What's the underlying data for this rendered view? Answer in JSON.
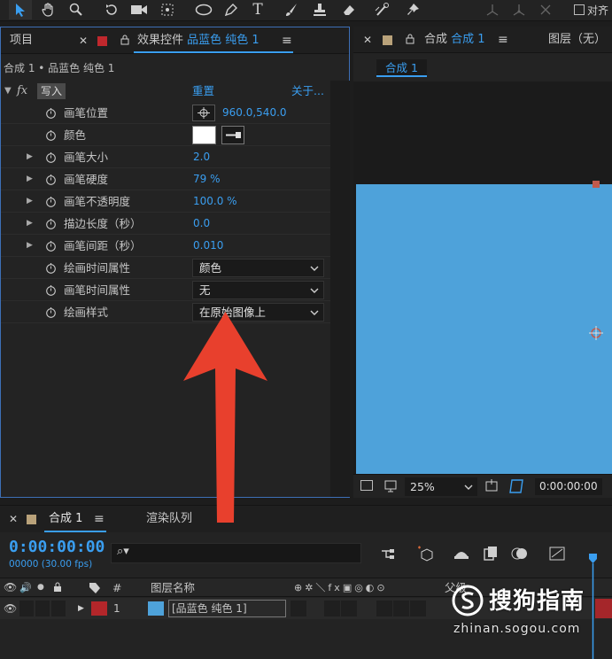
{
  "toolbar": {
    "right_label": "对齐"
  },
  "effects_panel": {
    "project_tab": "项目",
    "effects_tab_prefix": "效果控件",
    "effects_tab_layer": "品蓝色 纯色 1",
    "layer_title": "合成 1 • 品蓝色 纯色 1",
    "fx_label": "fx",
    "effect_name": "写入",
    "reset_label": "重置",
    "about_label": "关于...",
    "rows": [
      {
        "label": "画笔位置",
        "value": "960.0,540.0"
      },
      {
        "label": "颜色",
        "value": ""
      },
      {
        "label": "画笔大小",
        "value": "2.0"
      },
      {
        "label": "画笔硬度",
        "value": "79 %"
      },
      {
        "label": "画笔不透明度",
        "value": "100.0 %"
      },
      {
        "label": "描边长度（秒）",
        "value": "0.0"
      },
      {
        "label": "画笔间距（秒）",
        "value": "0.010"
      },
      {
        "label": "绘画时间属性",
        "value": "颜色"
      },
      {
        "label": "画笔时间属性",
        "value": "无"
      },
      {
        "label": "绘画样式",
        "value": "在原始图像上"
      }
    ]
  },
  "comp_panel": {
    "tab_prefix": "合成",
    "tab_name": "合成 1",
    "layer_tab": "图层（无）",
    "comp_chip": "合成 1",
    "solid_color": "#4ea2da",
    "zoom": "25%",
    "timecode": "0:00:00:00"
  },
  "timeline": {
    "tab_name": "合成 1",
    "render_queue_tab": "渲染队列",
    "timecode": "0:00:00:00",
    "fps": "00000 (30.00 fps)",
    "search_glyph": "⌕▾",
    "col_hash": "#",
    "col_layer_name": "图层名称",
    "col_parent": "父级",
    "layer_index": "1",
    "layer_name": "[品蓝色 纯色 1]"
  },
  "watermark": {
    "title": "搜狗指南",
    "url": "zhinan.sogou.com"
  },
  "colors": {
    "accent": "#3a9ef0",
    "annotation_arrow": "#e8402d",
    "layer_label_red": "#b3262a"
  }
}
